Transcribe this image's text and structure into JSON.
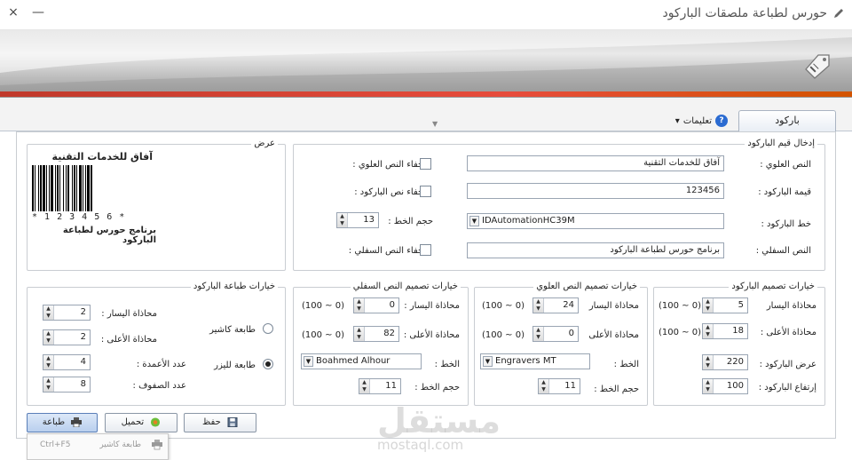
{
  "window": {
    "title": "حورس لطباعة ملصقات الباركود",
    "close_glyph": "×",
    "minimize_glyph": "—"
  },
  "tabs": {
    "barcode": "باركود",
    "help": "تعليمات",
    "help_arrow": "▾"
  },
  "display": {
    "legend": "عرض",
    "top_text": "آفاق للخدمات التقنية",
    "barcode_digits": "* 1 2 3 4 5 6 *",
    "bottom_text": "برنامج حورس لطباعة الباركود"
  },
  "input": {
    "legend": "إدخال قيم الباركود",
    "top_text_label": "النص العلوي :",
    "top_text_value": "آفاق للخدمات التقنية",
    "hide_top_text": "إخفاء النص العلوي :",
    "barcode_value_label": "قيمة الباركود :",
    "barcode_value": "123456",
    "hide_barcode_text": "إخفاء نص الباركود :",
    "font_size_label": "حجم الخط :",
    "font_size_value": "13",
    "barcode_font_label": "خط الباركود :",
    "barcode_font_value": "IDAutomationHC39M",
    "bottom_text_label": "النص السفلي :",
    "bottom_text_value": "برنامج حورس لطباعة الباركود",
    "hide_bottom_text": "إخفاء النص السفلي :"
  },
  "print_options": {
    "legend": "خيارات طباعة الباركود",
    "left_align_label": "محاذاة اليسار :",
    "left_align_value": "2",
    "top_align_label": "محاذاة الأعلى :",
    "top_align_value": "2",
    "columns_label": "عدد الأعمدة :",
    "columns_value": "4",
    "rows_label": "عدد الصفوف :",
    "rows_value": "8",
    "cashier_printer": "طابعة كاشير",
    "laser_printer": "طابعة لليزر"
  },
  "bottom_design": {
    "legend": "خيارات تصميم النص السفلي",
    "left_align_label": "محاذاة اليسار :",
    "left_align_value": "0",
    "top_align_label": "محاذاة الأعلى :",
    "top_align_value": "82",
    "range": "(0 ~ 100)",
    "font_label": "الخط :",
    "font_value": "Boahmed Alhour",
    "font_size_label": "حجم الخط :",
    "font_size_value": "11"
  },
  "top_design": {
    "legend": "خيارات تصميم النص العلوي",
    "left_align_label": "محاذاة اليسار",
    "left_align_value": "24",
    "top_align_label": "محاذاة الأعلى",
    "top_align_value": "0",
    "range": "(0 ~ 100)",
    "font_label": "الخط :",
    "font_value": "Engravers MT",
    "font_size_label": "حجم الخط :",
    "font_size_value": "11"
  },
  "barcode_design": {
    "legend": "خيارات تصميم الباركود",
    "left_align_label": "محاذاة اليسار",
    "left_align_value": "5",
    "top_align_label": "محاذاة الأعلى :",
    "top_align_value": "18",
    "range": "(0 ~ 100)",
    "width_label": "عرض الباركود :",
    "width_value": "220",
    "height_label": "إرتفاع الباركود :",
    "height_value": "100"
  },
  "buttons": {
    "print": "طباعة",
    "load": "تحميل",
    "save": "حفظ"
  },
  "print_menu": {
    "item": "طابعة كاشير",
    "shortcut": "Ctrl+F5"
  },
  "watermark": {
    "main": "مستقل",
    "sub": "mostaql.com"
  },
  "colors": {
    "accent": "#2b6bd1",
    "banner_stripe": "#c0392b"
  }
}
